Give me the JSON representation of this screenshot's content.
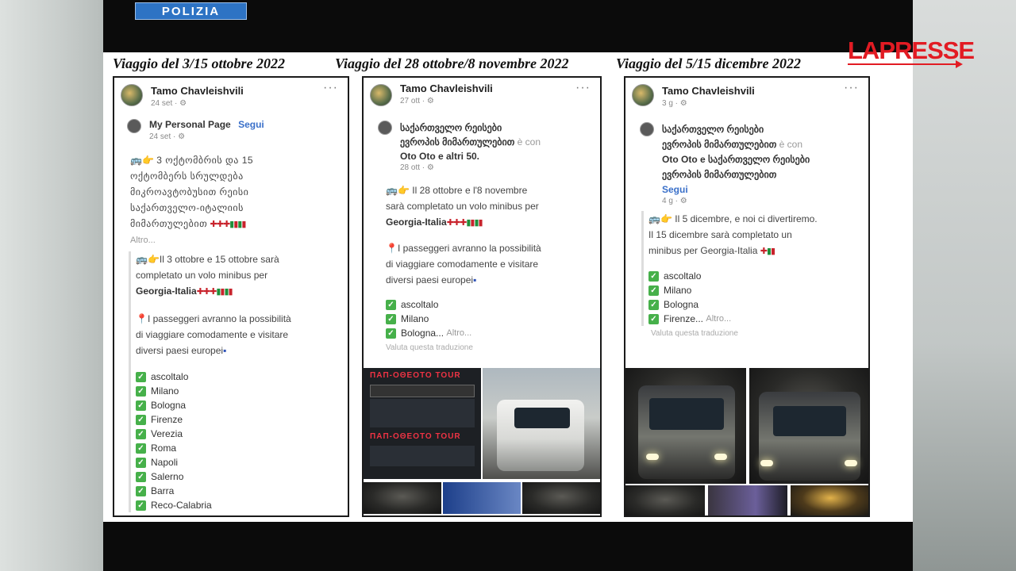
{
  "watermark": {
    "police": "POLIZIA",
    "agency": "LAPRESSE"
  },
  "captions": [
    "Viaggio del 3/15 ottobre 2022",
    "Viaggio del 28 ottobre/8 novembre 2022",
    "Viaggio del 5/15 dicembre 2022"
  ],
  "posts": [
    {
      "author": "Tamo Chavleishvili",
      "meta": "24 set · ⚙",
      "shared_author": "My Personal Page",
      "follow": "Segui",
      "shared_meta": "24 set · ⚙",
      "geo_text_1": "3 ოქტომბრის და 15",
      "geo_text_2": "ოქტომბერს  სრულდება",
      "geo_text_3": "მიკროავტობუსით რეისი",
      "geo_text_4": "საქართველო-იტალიის",
      "geo_text_5": "მიმართულებით",
      "more": "Altro...",
      "it_line_1": "Il 3 ottobre e 15 ottobre sarà",
      "it_line_2": "completato un volo minibus per",
      "it_line_3": "Georgia-Italia",
      "pass_1": "I passeggeri avranno la possibilità",
      "pass_2": "di viaggiare comodamente e visitare",
      "pass_3": "diversi paesi europei",
      "cities": [
        "ascoltalo",
        "Milano",
        "Bologna",
        "Firenze",
        "Verezia",
        "Roma",
        "Napoli",
        "Salerno",
        "Barra",
        "Reco-Calabria"
      ]
    },
    {
      "author": "Tamo Chavleishvili",
      "meta": "27 ott · ⚙",
      "group_1": "საქართველო რეისები",
      "group_2": "ევროპის მიმართულებით",
      "with": "è con",
      "tags": "Oto Oto e altri 50.",
      "group_meta": "28 ott · ⚙",
      "it_line_1": "Il 28 ottobre e l'8 novembre",
      "it_line_2": "sarà completato un volo minibus per",
      "it_line_3": "Georgia-Italia",
      "pass_1": "I passeggeri avranno la possibilità",
      "pass_2": "di viaggiare comodamente e visitare",
      "pass_3": "diversi paesi europei",
      "cities": [
        "ascoltalo",
        "Milano",
        "Bologna..."
      ],
      "more": "Altro...",
      "translate": "Valuta questa traduzione",
      "ad_title": "ΠΑΠ-ΟΘΕΟΤΟ ΤΟUR",
      "ad_title_2": "ΠΑΠ-ΟΘΕΟΤΟ ΤΟUR"
    },
    {
      "author": "Tamo Chavleishvili",
      "meta": "3 g · ⚙",
      "group_1": "საქართველო რეისები",
      "group_2": "ევროპის მიმართულებით",
      "with": "è con",
      "tags_1": "Oto Oto e საქართველო რეისები",
      "tags_2": "ევროპის მიმართულებით",
      "follow": "Segui",
      "group_meta": "4 g · ⚙",
      "it_line_1": "Il 5 dicembre, e noi ci divertiremo.",
      "it_line_2": "Il 15 dicembre sarà completato un",
      "it_line_3": "minibus per Georgia-Italia",
      "cities": [
        "ascoltalo",
        "Milano",
        "Bologna",
        "Firenze..."
      ],
      "more": "Altro...",
      "translate": "Valuta questa traduzione"
    }
  ]
}
